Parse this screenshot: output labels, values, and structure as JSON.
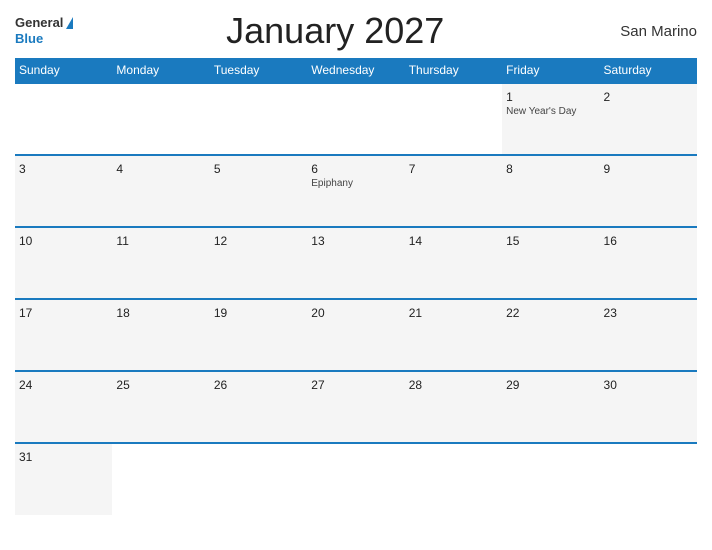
{
  "header": {
    "logo_general": "General",
    "logo_blue": "Blue",
    "title": "January 2027",
    "country": "San Marino"
  },
  "weekdays": [
    "Sunday",
    "Monday",
    "Tuesday",
    "Wednesday",
    "Thursday",
    "Friday",
    "Saturday"
  ],
  "weeks": [
    [
      {
        "day": "",
        "empty": true
      },
      {
        "day": "",
        "empty": true
      },
      {
        "day": "",
        "empty": true
      },
      {
        "day": "",
        "empty": true
      },
      {
        "day": "",
        "empty": true
      },
      {
        "day": "1",
        "event": "New Year's Day"
      },
      {
        "day": "2"
      }
    ],
    [
      {
        "day": "3"
      },
      {
        "day": "4"
      },
      {
        "day": "5"
      },
      {
        "day": "6",
        "event": "Epiphany"
      },
      {
        "day": "7"
      },
      {
        "day": "8"
      },
      {
        "day": "9"
      }
    ],
    [
      {
        "day": "10"
      },
      {
        "day": "11"
      },
      {
        "day": "12"
      },
      {
        "day": "13"
      },
      {
        "day": "14"
      },
      {
        "day": "15"
      },
      {
        "day": "16"
      }
    ],
    [
      {
        "day": "17"
      },
      {
        "day": "18"
      },
      {
        "day": "19"
      },
      {
        "day": "20"
      },
      {
        "day": "21"
      },
      {
        "day": "22"
      },
      {
        "day": "23"
      }
    ],
    [
      {
        "day": "24"
      },
      {
        "day": "25"
      },
      {
        "day": "26"
      },
      {
        "day": "27"
      },
      {
        "day": "28"
      },
      {
        "day": "29"
      },
      {
        "day": "30"
      }
    ],
    [
      {
        "day": "31"
      },
      {
        "day": "",
        "empty": true
      },
      {
        "day": "",
        "empty": true
      },
      {
        "day": "",
        "empty": true
      },
      {
        "day": "",
        "empty": true
      },
      {
        "day": "",
        "empty": true
      },
      {
        "day": "",
        "empty": true
      }
    ]
  ]
}
